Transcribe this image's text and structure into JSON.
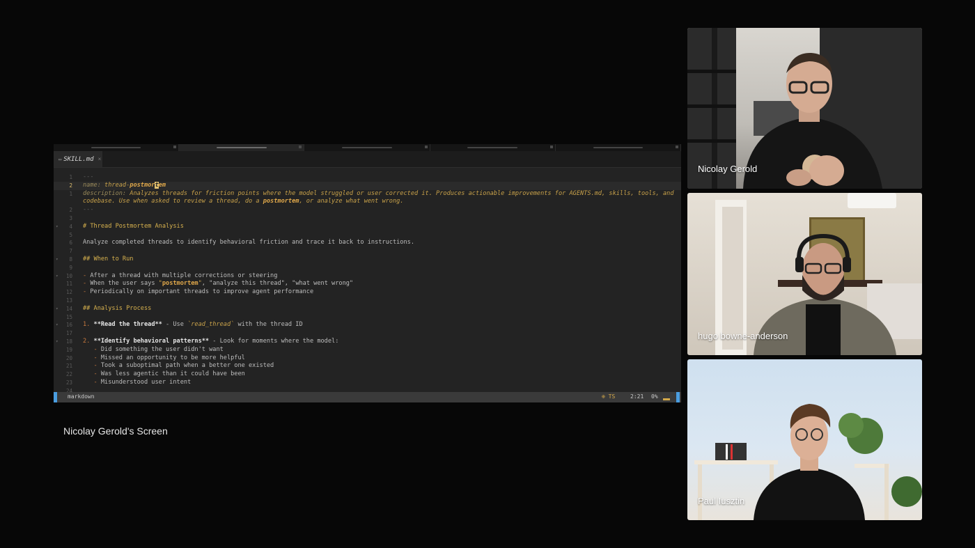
{
  "window_tabs": [
    "",
    "",
    "",
    "",
    "",
    ""
  ],
  "editor": {
    "file_icon": "md-file-icon",
    "file_name": "SKILL.md",
    "close_glyph": "×",
    "lines": [
      {
        "n": "1",
        "s": [
          {
            "t": "---",
            "c": "c-dash"
          }
        ]
      },
      {
        "n": "2",
        "cur": true,
        "s": [
          {
            "t": "name: ",
            "c": "c-key"
          },
          {
            "t": "thread-",
            "c": "c-yel"
          },
          {
            "t": "postmor",
            "c": "c-bold"
          },
          {
            "t": "t",
            "c": "c-bold cursor"
          },
          {
            "t": "em",
            "c": "c-bold"
          }
        ]
      },
      {
        "n": "1",
        "s": [
          {
            "t": "description: ",
            "c": "c-key"
          },
          {
            "t": "Analyzes threads for friction points where the model struggled or user corrected it. Produces actionable improvements for AGENTS.md, skills, tools, and",
            "c": "c-yel"
          }
        ]
      },
      {
        "n": "",
        "s": [
          {
            "t": "codebase. Use when asked to review a thread, do a ",
            "c": "c-yel"
          },
          {
            "t": "postmortem",
            "c": "c-bold"
          },
          {
            "t": ", or analyze what went wrong.",
            "c": "c-yel"
          }
        ]
      },
      {
        "n": "2",
        "s": [
          {
            "t": "---",
            "c": "c-dash"
          }
        ]
      },
      {
        "n": "3",
        "s": []
      },
      {
        "n": "4",
        "fold": true,
        "s": [
          {
            "t": "# Thread Postmortem Analysis",
            "c": "c-head"
          }
        ]
      },
      {
        "n": "5",
        "s": []
      },
      {
        "n": "6",
        "s": [
          {
            "t": "Analyze completed threads to identify behavioral friction and trace it back to instructions.",
            "c": ""
          }
        ]
      },
      {
        "n": "7",
        "s": []
      },
      {
        "n": "8",
        "fold": true,
        "s": [
          {
            "t": "## When to Run",
            "c": "c-head"
          }
        ]
      },
      {
        "n": "9",
        "s": []
      },
      {
        "n": "10",
        "fold": true,
        "s": [
          {
            "t": "- ",
            "c": "c-list"
          },
          {
            "t": "After a thread with multiple corrections or steering",
            "c": ""
          }
        ]
      },
      {
        "n": "11",
        "s": [
          {
            "t": "- ",
            "c": "c-list"
          },
          {
            "t": "When the user says ",
            "c": ""
          },
          {
            "t": "\"",
            "c": "c-str"
          },
          {
            "t": "postmortem",
            "c": "c-strb"
          },
          {
            "t": "\"",
            "c": "c-str"
          },
          {
            "t": ", \"analyze this thread\", \"what went wrong\"",
            "c": ""
          }
        ]
      },
      {
        "n": "12",
        "s": [
          {
            "t": "- ",
            "c": "c-list"
          },
          {
            "t": "Periodically on important threads to improve agent performance",
            "c": ""
          }
        ]
      },
      {
        "n": "13",
        "s": []
      },
      {
        "n": "14",
        "fold": true,
        "s": [
          {
            "t": "## Analysis Process",
            "c": "c-head"
          }
        ]
      },
      {
        "n": "15",
        "s": []
      },
      {
        "n": "16",
        "fold": true,
        "s": [
          {
            "t": "1. ",
            "c": "c-list"
          },
          {
            "t": "**Read the thread**",
            "c": "c-em"
          },
          {
            "t": " - Use ",
            "c": ""
          },
          {
            "t": "`read_thread`",
            "c": "c-code"
          },
          {
            "t": " with the thread ID",
            "c": ""
          }
        ]
      },
      {
        "n": "17",
        "s": []
      },
      {
        "n": "18",
        "fold": true,
        "s": [
          {
            "t": "2. ",
            "c": "c-list"
          },
          {
            "t": "**Identify behavioral patterns**",
            "c": "c-em"
          },
          {
            "t": " - Look for moments where the model:",
            "c": ""
          }
        ]
      },
      {
        "n": "19",
        "s": [
          {
            "t": "   - ",
            "c": "c-list"
          },
          {
            "t": "Did something the user didn't want",
            "c": ""
          }
        ]
      },
      {
        "n": "20",
        "s": [
          {
            "t": "   - ",
            "c": "c-list"
          },
          {
            "t": "Missed an opportunity to be more helpful",
            "c": ""
          }
        ]
      },
      {
        "n": "21",
        "s": [
          {
            "t": "   - ",
            "c": "c-list"
          },
          {
            "t": "Took a suboptimal path when a better one existed",
            "c": ""
          }
        ]
      },
      {
        "n": "22",
        "s": [
          {
            "t": "   - ",
            "c": "c-list"
          },
          {
            "t": "Was less agentic than it could have been",
            "c": ""
          }
        ]
      },
      {
        "n": "23",
        "s": [
          {
            "t": "   - ",
            "c": "c-list"
          },
          {
            "t": "Misunderstood user intent",
            "c": ""
          }
        ]
      },
      {
        "n": "24",
        "s": []
      }
    ]
  },
  "statusbar": {
    "mode": "markdown",
    "lsp": "⊕ TS",
    "cursor_pos": "2:21",
    "scroll_pct": "0%"
  },
  "screen_label": "Nicolay Gerold's Screen",
  "participants": [
    {
      "name": "Nicolay Gerold"
    },
    {
      "name": "hugo bowne-anderson"
    },
    {
      "name": "Paul Iusztin"
    }
  ],
  "colors": {
    "accent": "#4a9de0",
    "status_yellow": "#d4a94a"
  }
}
